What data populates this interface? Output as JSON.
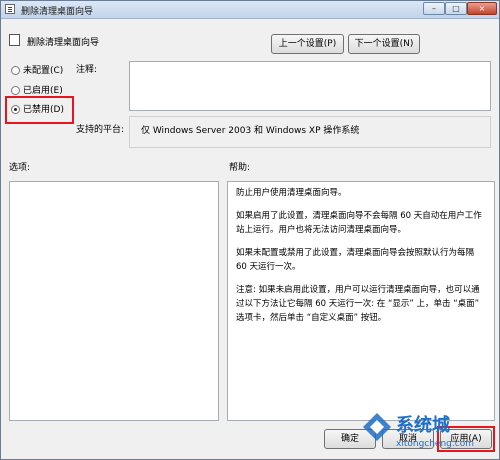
{
  "window": {
    "title": "删除清理桌面向导",
    "controls": {
      "minimize": "–",
      "maximize": "□",
      "close": "×"
    }
  },
  "setting": {
    "title": "删除清理桌面向导",
    "prev_label": "上一个设置(P)",
    "next_label": "下一个设置(N)"
  },
  "state": {
    "options": [
      {
        "label": "未配置(C)",
        "selected": false
      },
      {
        "label": "已启用(E)",
        "selected": false
      },
      {
        "label": "已禁用(D)",
        "selected": true
      }
    ]
  },
  "comment": {
    "label": "注释:",
    "value": ""
  },
  "platform": {
    "label": "支持的平台:",
    "value": "仅 Windows Server 2003 和 Windows XP 操作系统"
  },
  "panels": {
    "options_label": "选项:",
    "help_label": "帮助:"
  },
  "help": {
    "paragraphs": [
      "防止用户使用清理桌面向导。",
      "如果启用了此设置，清理桌面向导不会每隔 60 天自动在用户工作站上运行。用户也将无法访问清理桌面向导。",
      "如果未配置或禁用了此设置，清理桌面向导会按照默认行为每隔 60 天运行一次。",
      "注意: 如果未启用此设置，用户可以运行清理桌面向导，也可以通过以下方法让它每隔 60 天运行一次: 在 “显示” 上，单击 “桌面” 选项卡，然后单击 “自定义桌面” 按钮。"
    ]
  },
  "footer": {
    "ok_label": "确定",
    "cancel_label": "取消",
    "apply_label": "应用(A)"
  },
  "watermark": {
    "text": "系统城",
    "url": "xitongcheng.com"
  },
  "colors": {
    "highlight": "#e8141e",
    "watermark": "#1e6fc8"
  }
}
